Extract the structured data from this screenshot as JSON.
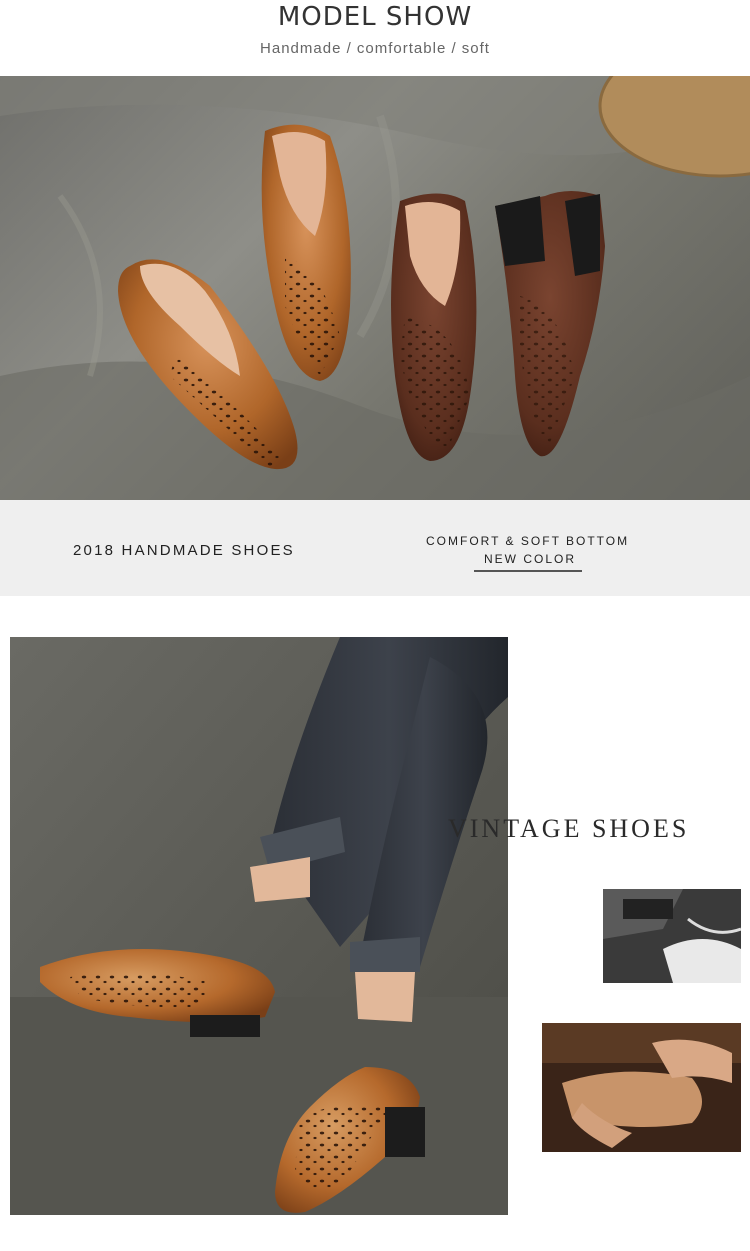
{
  "header": {
    "title": "MODEL SHOW",
    "subtitle": "Handmade / comfortable / soft"
  },
  "hero_image": {
    "icon": "shoes-flatlay-photo"
  },
  "banner": {
    "left_text": "2018 HANDMADE SHOES",
    "right_line1": "COMFORT & SOFT BOTTOM",
    "right_line2": "NEW COLOR"
  },
  "model_image": {
    "icon": "model-wearing-shoes-photo"
  },
  "side": {
    "heading": "VINTAGE SHOES",
    "thumb1_icon": "sewing-machine-photo",
    "thumb2_icon": "leather-crafting-photo"
  },
  "colors": {
    "tan_leather": "#b0662a",
    "brown_leather": "#5a2e1e",
    "background": "#ffffff",
    "banner": "#efefef"
  }
}
